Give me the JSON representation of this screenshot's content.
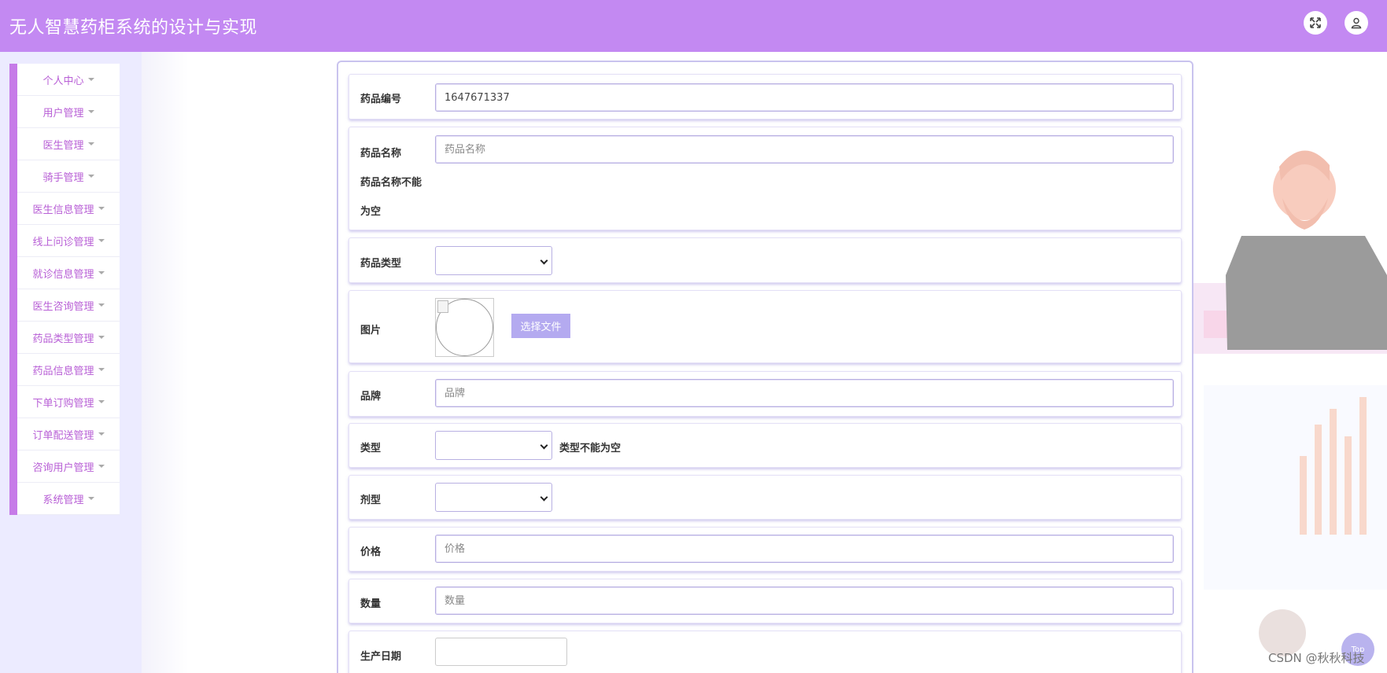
{
  "header": {
    "title": "无人智慧药柜系统的设计与实现",
    "fullscreen_icon": "expand-icon",
    "user_icon": "user-icon"
  },
  "sidebar": {
    "items": [
      {
        "label": "个人中心"
      },
      {
        "label": "用户管理"
      },
      {
        "label": "医生管理"
      },
      {
        "label": "骑手管理"
      },
      {
        "label": "医生信息管理"
      },
      {
        "label": "线上问诊管理"
      },
      {
        "label": "就诊信息管理"
      },
      {
        "label": "医生咨询管理"
      },
      {
        "label": "药品类型管理"
      },
      {
        "label": "药品信息管理"
      },
      {
        "label": "下单订购管理"
      },
      {
        "label": "订单配送管理"
      },
      {
        "label": "咨询用户管理"
      },
      {
        "label": "系统管理"
      }
    ]
  },
  "form": {
    "drug_code": {
      "label": "药品编号",
      "value": "1647671337"
    },
    "drug_name": {
      "label": "药品名称",
      "placeholder": "药品名称",
      "error_line1": "药品名称不能",
      "error_line2": "为空"
    },
    "drug_category": {
      "label": "药品类型",
      "value": ""
    },
    "image": {
      "label": "图片",
      "button": "选择文件"
    },
    "brand": {
      "label": "品牌",
      "placeholder": "品牌"
    },
    "type": {
      "label": "类型",
      "value": "",
      "error": "类型不能为空"
    },
    "dosage_form": {
      "label": "剂型",
      "value": ""
    },
    "price": {
      "label": "价格",
      "placeholder": "价格"
    },
    "quantity": {
      "label": "数量",
      "placeholder": "数量"
    },
    "production_date": {
      "label": "生产日期",
      "value": ""
    }
  },
  "watermark": "CSDN @秋秋科技",
  "back_to_top": "Top",
  "colors": {
    "header_bg": "#c389f2",
    "sidebar_accent": "#c67be8",
    "menu_text": "#b85fd6",
    "button_bg": "#b4aaf0"
  }
}
